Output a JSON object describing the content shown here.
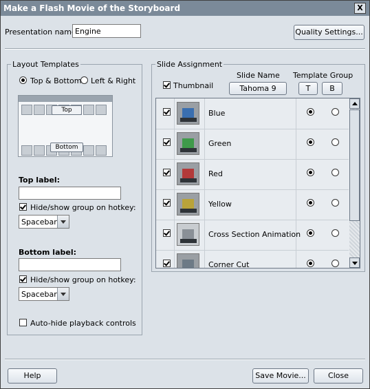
{
  "window": {
    "title": "Make a Flash Movie of the Storyboard",
    "close_label": "X"
  },
  "presentation": {
    "label": "Presentation name:",
    "value": "Engine"
  },
  "quality_button": "Quality Settings...",
  "layout": {
    "legend": "Layout Templates",
    "option_top_bottom": "Top & Bottom",
    "option_left_right": "Left & Right",
    "selected": "Top & Bottom",
    "preview_top": "Top",
    "preview_bottom": "Bottom",
    "top_label": {
      "title": "Top label:",
      "value": "",
      "hotkey_check": "Hide/show group on hotkey:",
      "hotkey_checked": true,
      "hotkey_value": "Spacebar"
    },
    "bottom_label": {
      "title": "Bottom label:",
      "value": "",
      "hotkey_check": "Hide/show group on hotkey:",
      "hotkey_checked": true,
      "hotkey_value": "Spacebar"
    },
    "autohide": {
      "label": "Auto-hide playback controls",
      "checked": false
    }
  },
  "slides": {
    "legend": "Slide Assignment",
    "thumbnail_label": "Thumbnail",
    "thumbnail_checked": true,
    "slide_name_header": "Slide Name",
    "font_button": "Tahoma 9",
    "template_group_header": "Template Group",
    "top_button": "T",
    "bottom_button": "B",
    "rows": [
      {
        "name": "Blue",
        "checked": true,
        "group": "T",
        "accent": "#3a6fb0"
      },
      {
        "name": "Green",
        "checked": true,
        "group": "T",
        "accent": "#3f9a4a"
      },
      {
        "name": "Red",
        "checked": true,
        "group": "T",
        "accent": "#b33a3a"
      },
      {
        "name": "Yellow",
        "checked": true,
        "group": "T",
        "accent": "#b9a33a"
      },
      {
        "name": "Cross Section Animation",
        "checked": true,
        "group": "T",
        "accent": "#8a9097"
      },
      {
        "name": "Corner Cut",
        "checked": true,
        "group": "T",
        "accent": "#6d7a86"
      }
    ]
  },
  "footer": {
    "help": "Help",
    "save": "Save Movie...",
    "close": "Close"
  }
}
